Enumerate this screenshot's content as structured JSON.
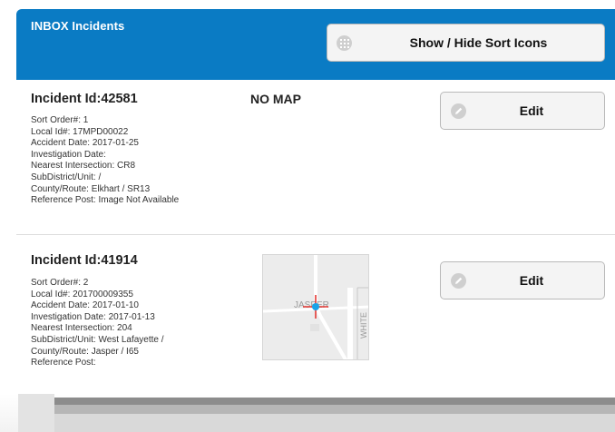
{
  "header": {
    "title": "INBOX Incidents",
    "sort_button_label": "Show / Hide Sort Icons"
  },
  "incidents": [
    {
      "title": "Incident Id:42581",
      "map_label": "NO MAP",
      "edit_label": "Edit",
      "details": [
        "Sort Order#: 1",
        "Local Id#: 17MPD00022",
        "Accident Date: 2017-01-25",
        "Investigation Date:",
        "Nearest Intersection: CR8",
        "SubDistrict/Unit: /",
        "County/Route: Elkhart / SR13",
        "Reference Post: Image Not Available"
      ]
    },
    {
      "title": "Incident Id:41914",
      "edit_label": "Edit",
      "map": {
        "label_town": "JASPER",
        "label_road": "WHITE"
      },
      "details": [
        "Sort Order#: 2",
        "Local Id#: 201700009355",
        "Accident Date: 2017-01-10",
        "Investigation Date: 2017-01-13",
        "Nearest Intersection: 204",
        "SubDistrict/Unit: West Lafayette /",
        "County/Route: Jasper / I65",
        "Reference Post:"
      ]
    }
  ],
  "colors": {
    "header_bg": "#0a7bc4",
    "marker": "#1aa3e8",
    "crosshair": "#e53935"
  }
}
